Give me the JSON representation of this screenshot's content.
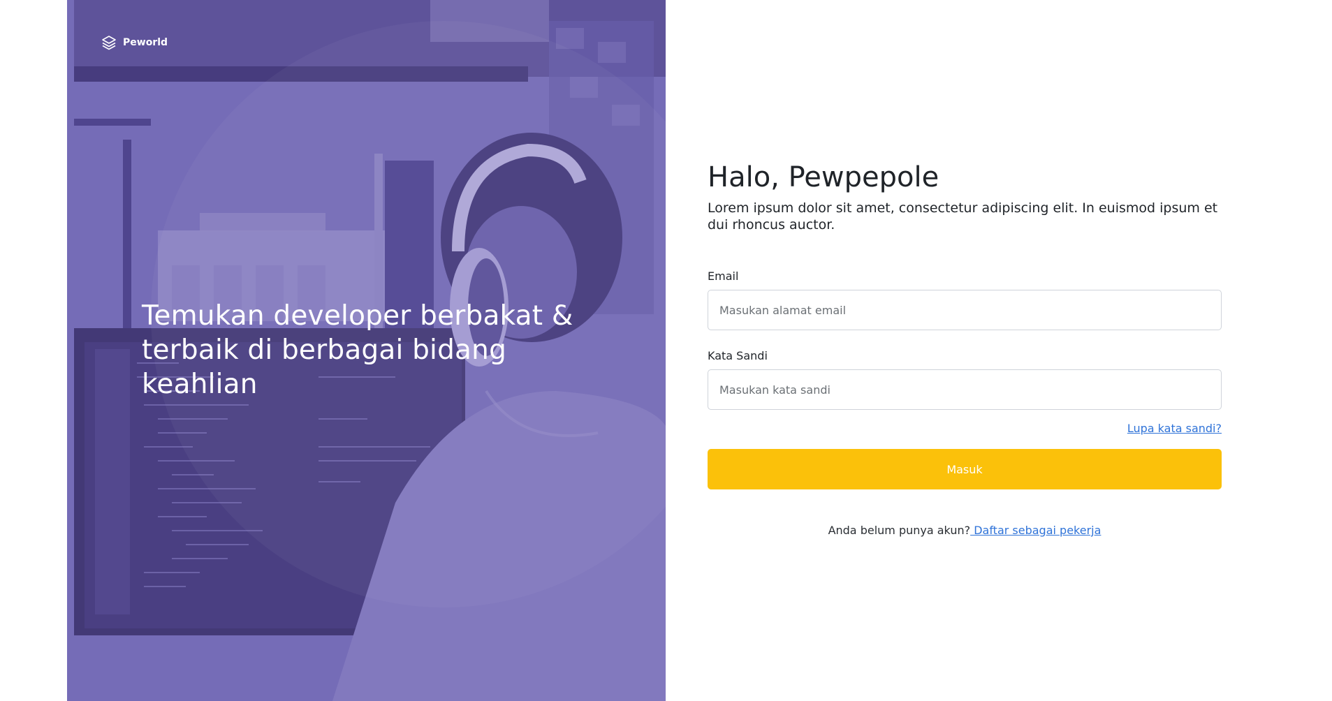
{
  "brand": {
    "name": "Peworld",
    "icon": "layers-icon"
  },
  "hero": {
    "headline": "Temukan developer berbakat & terbaik di berbagai bidang keahlian",
    "overlay_color": "#7b72bd"
  },
  "login": {
    "title": "Halo, Pewpepole",
    "subtitle": "Lorem ipsum dolor sit amet, consectetur adipiscing elit. In euismod ipsum et dui rhoncus auctor.",
    "email": {
      "label": "Email",
      "placeholder": "Masukan alamat email",
      "value": ""
    },
    "password": {
      "label": "Kata Sandi",
      "placeholder": "Masukan kata sandi",
      "value": ""
    },
    "forgot_link": "Lupa kata sandi?",
    "submit_label": "Masuk",
    "register_prompt": "Anda belum punya akun?",
    "register_link": " Daftar sebagai pekerja"
  },
  "colors": {
    "accent": "#fbc10a",
    "link": "#2f73d8",
    "hero_purple": "#7b72bd"
  }
}
